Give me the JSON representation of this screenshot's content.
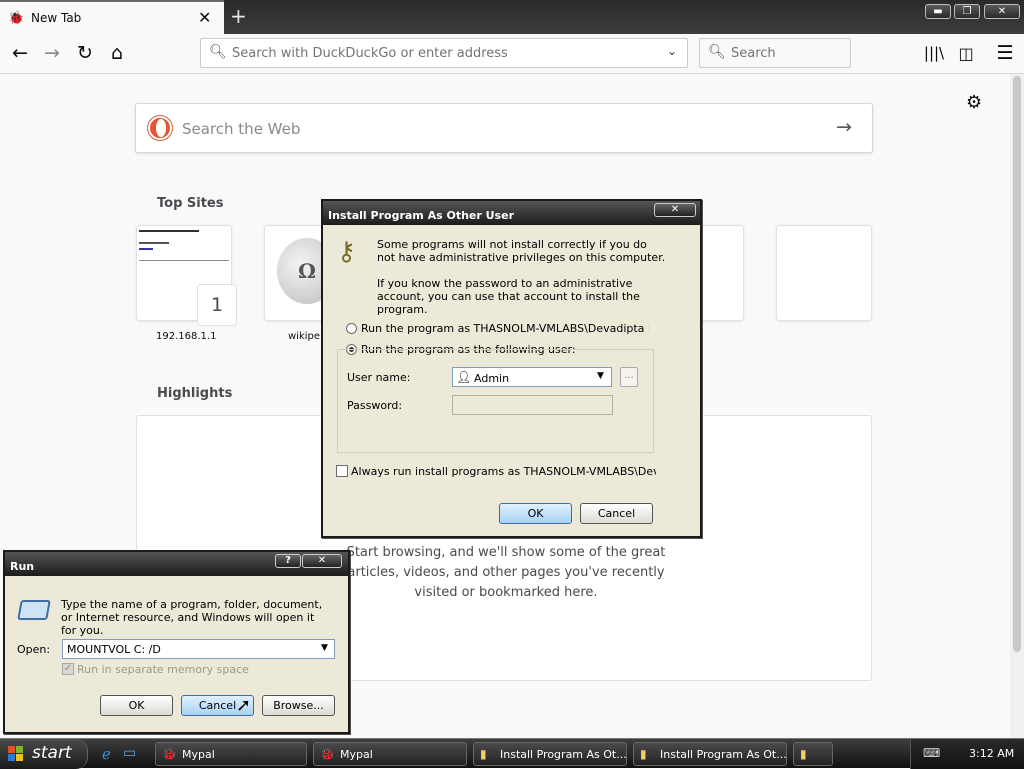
{
  "browser": {
    "tab_title": "New Tab",
    "url_placeholder": "Search with DuckDuckGo or enter address",
    "search_placeholder": "Search"
  },
  "newtab": {
    "web_search_placeholder": "Search the Web",
    "top_sites_heading": "Top Sites",
    "sites": [
      {
        "label": "192.168.1.1",
        "badge": "1"
      },
      {
        "label": "wikipe"
      }
    ],
    "highlights_heading": "Highlights",
    "highlights_empty_text": "Start browsing, and we'll show some of the great articles, videos, and other pages you've recently visited or bookmarked here."
  },
  "install_dialog": {
    "title": "Install Program As Other User",
    "close": "✕",
    "message1": "Some programs will not install correctly if you do not have administrative privileges on this computer.",
    "message2": "If you know the password to an administrative account, you can use that account to install the program.",
    "radio_current": "Run the program as THASNOLM-VMLABS\\Devadipta Raka",
    "radio_other": "Run the program as the following user:",
    "username_label": "User name:",
    "username_value": "Admin",
    "password_label": "Password:",
    "browse_label": "...",
    "always_label": "Always run install programs as THASNOLM-VMLABS\\Devadipta",
    "ok": "OK",
    "cancel": "Cancel"
  },
  "run_dialog": {
    "title": "Run",
    "help": "?",
    "close": "✕",
    "message": "Type the name of a program, folder, document, or Internet resource, and Windows will open it for you.",
    "open_label": "Open:",
    "open_value": "MOUNTVOL C: /D",
    "separate_memory": "Run in separate memory space",
    "ok": "OK",
    "cancel": "Cancel",
    "browse": "Browse..."
  },
  "taskbar": {
    "start": "start",
    "tasks": [
      {
        "label": "Mypal"
      },
      {
        "label": "Mypal"
      },
      {
        "label": "Install Program As Ot..."
      },
      {
        "label": "Install Program As Ot..."
      },
      {
        "label": ""
      }
    ],
    "clock": "3:12 AM"
  }
}
